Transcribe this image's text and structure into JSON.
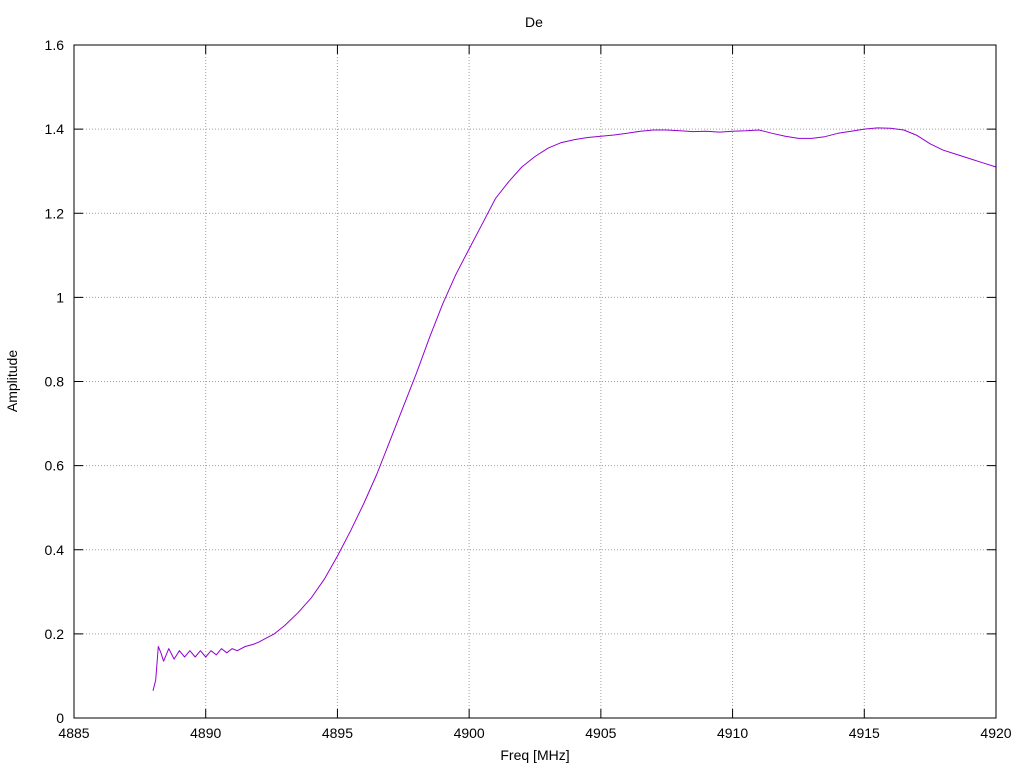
{
  "chart_data": {
    "type": "line",
    "title": "De",
    "xlabel": "Freq [MHz]",
    "ylabel": "Amplitude",
    "xlim": [
      4885,
      4920
    ],
    "ylim": [
      0,
      1.6
    ],
    "grid": true,
    "xticks": [
      4885,
      4890,
      4895,
      4900,
      4905,
      4910,
      4915,
      4920
    ],
    "xtick_labels": [
      "4885",
      "4890",
      "4895",
      "4900",
      "4905",
      "4910",
      "4915",
      "4920"
    ],
    "yticks": [
      0,
      0.2,
      0.4,
      0.6,
      0.8,
      1,
      1.2,
      1.4,
      1.6
    ],
    "ytick_labels": [
      "0",
      "0.2",
      "0.4",
      "0.6",
      "0.8",
      "1",
      "1.2",
      "1.4",
      "1.6"
    ],
    "colors": {
      "series": "#9400d3",
      "grid": "#a0a0a0",
      "axes": "#000000"
    },
    "series": [
      {
        "name": "",
        "x": [
          4888.0,
          4888.1,
          4888.2,
          4888.3,
          4888.4,
          4888.6,
          4888.8,
          4889.0,
          4889.2,
          4889.4,
          4889.6,
          4889.8,
          4890.0,
          4890.2,
          4890.4,
          4890.6,
          4890.8,
          4891.0,
          4891.2,
          4891.5,
          4891.8,
          4892.0,
          4892.3,
          4892.6,
          4893.0,
          4893.5,
          4894.0,
          4894.5,
          4895.0,
          4895.5,
          4896.0,
          4896.5,
          4897.0,
          4897.5,
          4898.0,
          4898.5,
          4899.0,
          4899.5,
          4900.0,
          4900.5,
          4901.0,
          4901.5,
          4902.0,
          4902.5,
          4903.0,
          4903.5,
          4904.0,
          4904.5,
          4905.0,
          4905.5,
          4906.0,
          4906.5,
          4907.0,
          4907.5,
          4908.0,
          4908.5,
          4909.0,
          4909.5,
          4910.0,
          4910.5,
          4911.0,
          4911.5,
          4912.0,
          4912.5,
          4913.0,
          4913.5,
          4914.0,
          4914.5,
          4915.0,
          4915.5,
          4916.0,
          4916.5,
          4917.0,
          4917.5,
          4918.0,
          4918.5,
          4919.0,
          4919.5,
          4920.0
        ],
        "y": [
          0.065,
          0.09,
          0.17,
          0.155,
          0.135,
          0.165,
          0.14,
          0.16,
          0.145,
          0.16,
          0.145,
          0.16,
          0.145,
          0.16,
          0.15,
          0.165,
          0.155,
          0.165,
          0.16,
          0.17,
          0.175,
          0.18,
          0.19,
          0.2,
          0.22,
          0.25,
          0.285,
          0.33,
          0.385,
          0.445,
          0.51,
          0.58,
          0.66,
          0.74,
          0.82,
          0.905,
          0.985,
          1.055,
          1.115,
          1.175,
          1.235,
          1.275,
          1.31,
          1.335,
          1.355,
          1.368,
          1.375,
          1.38,
          1.383,
          1.386,
          1.39,
          1.395,
          1.398,
          1.398,
          1.396,
          1.394,
          1.395,
          1.393,
          1.395,
          1.396,
          1.398,
          1.39,
          1.383,
          1.378,
          1.378,
          1.382,
          1.39,
          1.395,
          1.4,
          1.403,
          1.402,
          1.398,
          1.385,
          1.365,
          1.35,
          1.34,
          1.33,
          1.32,
          1.31
        ]
      }
    ]
  }
}
